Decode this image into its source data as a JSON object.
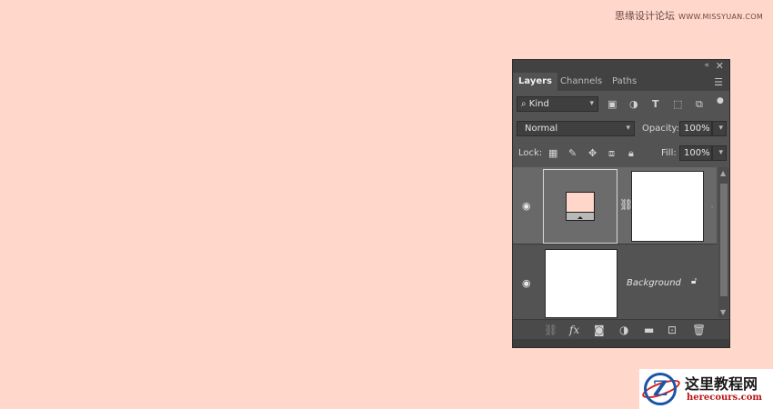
{
  "watermark_top": {
    "text": "思缘设计论坛",
    "site": "WWW.MISSYUAN.COM"
  },
  "panel": {
    "titlebar": {
      "collapse_icon": "«",
      "close_icon": "✕"
    },
    "tabs": [
      {
        "label": "Layers",
        "active": true
      },
      {
        "label": "Channels",
        "active": false
      },
      {
        "label": "Paths",
        "active": false
      }
    ],
    "filter": {
      "kind_label": "Kind",
      "filter_icons": [
        "image-filter-icon",
        "adjustment-filter-icon",
        "type-filter-icon",
        "shape-filter-icon",
        "smart-object-filter-icon"
      ]
    },
    "blend": {
      "mode": "Normal",
      "opacity_label": "Opacity:",
      "opacity_value": "100%"
    },
    "lock": {
      "label": "Lock:",
      "fill_label": "Fill:",
      "fill_value": "100%"
    },
    "layers": [
      {
        "name": "",
        "type": "smart-object-with-mask"
      },
      {
        "name": "Background",
        "type": "background",
        "locked": true
      }
    ],
    "bottom_bar": {
      "icons": [
        "link-icon",
        "fx-icon",
        "mask-icon",
        "adjustment-icon",
        "folder-icon",
        "new-layer-icon",
        "trash-icon"
      ]
    }
  },
  "logo": {
    "cn": "这里教程网",
    "en": "herecours.com"
  },
  "colors": {
    "background": "#ffd7cb",
    "panel": "#535353",
    "selected_layer": "#696969"
  }
}
